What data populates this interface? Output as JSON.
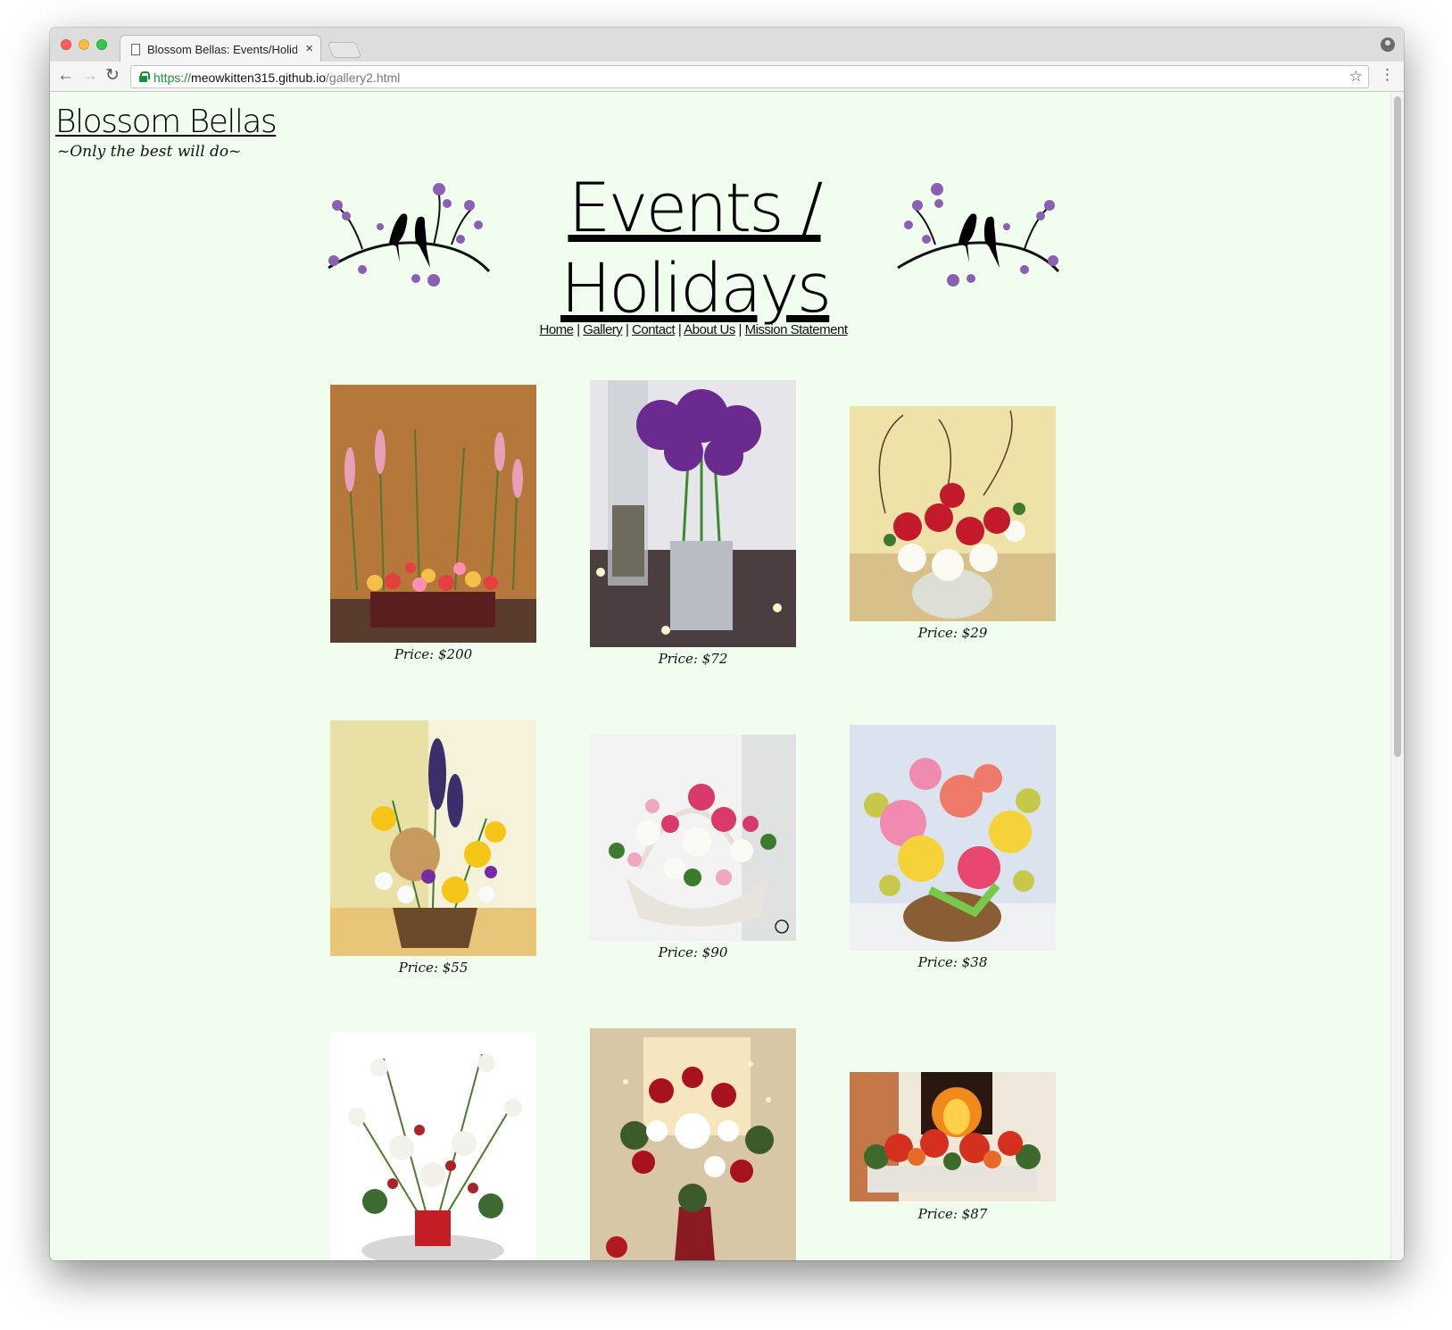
{
  "browser": {
    "tab_title": "Blossom Bellas: Events/Holidays",
    "url_scheme": "https://",
    "url_host": "meowkitten315.github.io",
    "url_path": "/gallery2.html"
  },
  "site": {
    "logo": "Blossom Bellas",
    "tagline": "~Only the best will do~"
  },
  "page": {
    "heading": "Events / Holidays"
  },
  "nav": {
    "home": "Home",
    "gallery": "Gallery",
    "contact": "Contact",
    "about": "About Us",
    "mission": "Mission Statement",
    "separator": "|"
  },
  "gallery": [
    {
      "price": "Price: $200",
      "icon": "flower-arrangement-image"
    },
    {
      "price": "Price: $72",
      "icon": "flower-arrangement-image"
    },
    {
      "price": "Price: $29",
      "icon": "flower-arrangement-image"
    },
    {
      "price": "Price: $55",
      "icon": "flower-arrangement-image"
    },
    {
      "price": "Price: $90",
      "icon": "flower-arrangement-image"
    },
    {
      "price": "Price: $38",
      "icon": "flower-arrangement-image"
    },
    {
      "price": "",
      "icon": "flower-arrangement-image"
    },
    {
      "price": "",
      "icon": "flower-arrangement-image"
    },
    {
      "price": "Price: $87",
      "icon": "flower-arrangement-image"
    }
  ],
  "colors": {
    "page_background": "#f0fdef",
    "accent_purple": "#8b5fb3",
    "bird": "#000000"
  }
}
